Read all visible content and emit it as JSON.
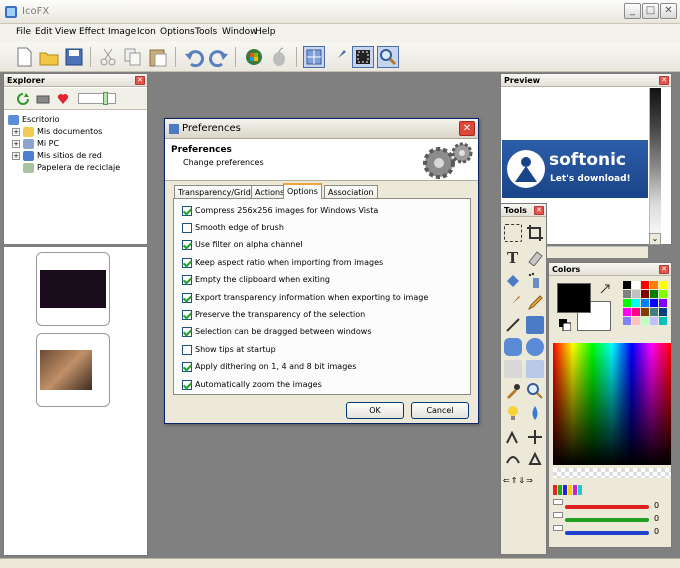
{
  "app": {
    "title": "IcoFX"
  },
  "window_buttons": {
    "minimize": "_",
    "maximize": "□",
    "close": "✕"
  },
  "menu": [
    "File",
    "Edit",
    "View",
    "Effect",
    "Image",
    "Icon",
    "Options",
    "Tools",
    "Window",
    "Help"
  ],
  "explorer": {
    "title": "Explorer",
    "tree": [
      {
        "label": "Escritorio",
        "expander": ""
      },
      {
        "label": "Mis documentos",
        "expander": "+"
      },
      {
        "label": "Mi PC",
        "expander": "+"
      },
      {
        "label": "Mis sitios de red",
        "expander": "+"
      },
      {
        "label": "Papelera de reciclaje",
        "expander": ""
      }
    ]
  },
  "dialog": {
    "title": "Preferences",
    "header_title": "Preferences",
    "header_subtitle": "Change preferences",
    "tabs": [
      "Transparency/Grid",
      "Actions",
      "Options",
      "Association"
    ],
    "active_tab": "Options",
    "options": [
      {
        "label": "Compress 256x256 images for Windows Vista",
        "checked": true
      },
      {
        "label": "Smooth edge of brush",
        "checked": false
      },
      {
        "label": "Use filter on alpha channel",
        "checked": true
      },
      {
        "label": "Keep aspect ratio when importing from images",
        "checked": true
      },
      {
        "label": "Empty the clipboard when exiting",
        "checked": true
      },
      {
        "label": "Export transparency information when exporting to image",
        "checked": true
      },
      {
        "label": "Preserve the transparency of the selection",
        "checked": true
      },
      {
        "label": "Selection can be dragged between windows",
        "checked": true
      },
      {
        "label": "Show tips at startup",
        "checked": false
      },
      {
        "label": "Apply dithering on 1, 4 and 8 bit images",
        "checked": true
      },
      {
        "label": "Automatically zoom the images",
        "checked": true
      }
    ],
    "ok_label": "OK",
    "cancel_label": "Cancel"
  },
  "preview": {
    "title": "Preview",
    "banner_text": "softonic",
    "banner_tagline": "Let's download!"
  },
  "tools": {
    "title": "Tools"
  },
  "colors": {
    "title": "Colors",
    "sliders": [
      {
        "color": "#e02020",
        "value": "0"
      },
      {
        "color": "#20a020",
        "value": "0"
      },
      {
        "color": "#2040d0",
        "value": "0"
      }
    ],
    "palette": [
      "#000000",
      "#ffffff",
      "#ff0000",
      "#ff8000",
      "#ffff00",
      "#808080",
      "#c0c0c0",
      "#800000",
      "#008000",
      "#80ff00",
      "#00ff00",
      "#00ffff",
      "#0080ff",
      "#0000ff",
      "#8000ff",
      "#ff00ff",
      "#ff0080",
      "#804000",
      "#408080",
      "#004080",
      "#8080ff",
      "#ffc0c0",
      "#c0ffc0",
      "#c0c0ff",
      "#00c0c0"
    ]
  }
}
